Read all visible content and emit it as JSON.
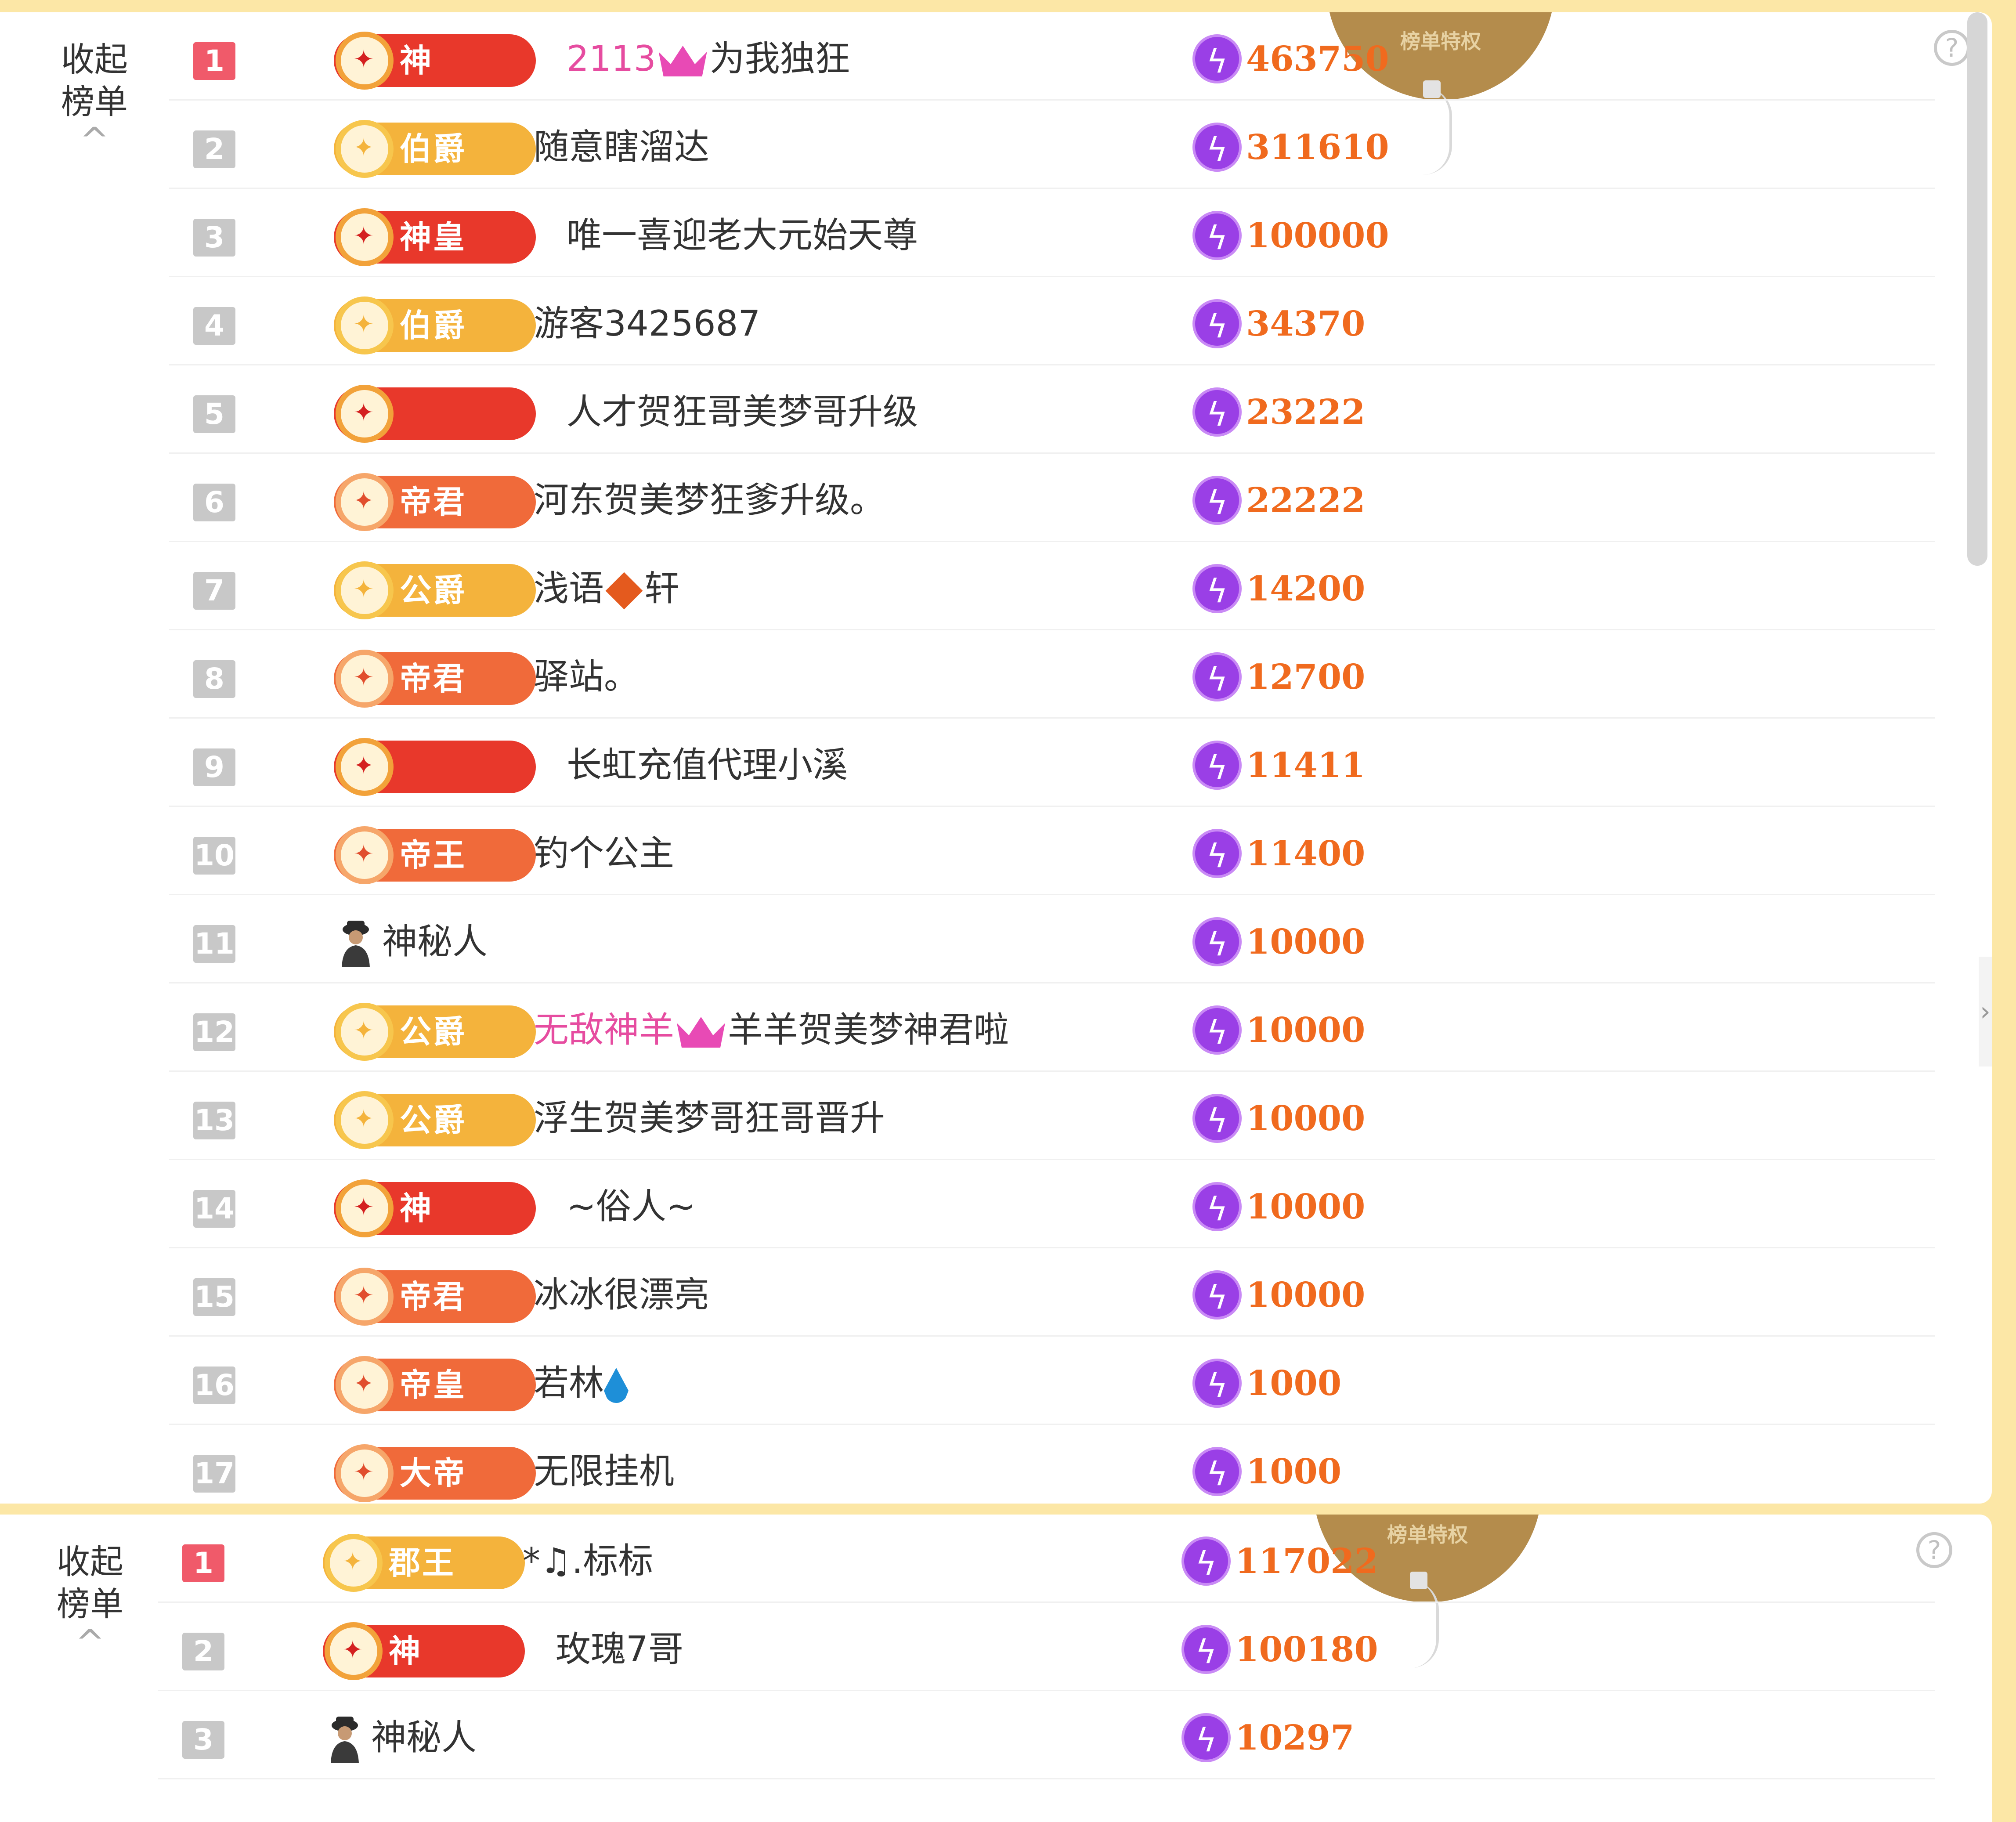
{
  "collapse_label_line1": "收起",
  "collapse_label_line2": "榜单",
  "collapse_caret": "^",
  "help_icon": "?",
  "medal_label": "榜单特权",
  "colors": {
    "score": "#f06a1e",
    "rank_top": "#f05a6a",
    "rank_other": "#c8c8c8",
    "accent_pink": "#e64ca0"
  },
  "board1": {
    "rows": [
      {
        "rank": "1",
        "badge_style": "red",
        "badge_text": "神",
        "name_pink": "2113",
        "crown": true,
        "name": "为我独狂",
        "score": "463750"
      },
      {
        "rank": "2",
        "badge_style": "gold",
        "badge_text": "伯爵",
        "name": "随意瞎溜达",
        "score": "311610"
      },
      {
        "rank": "3",
        "badge_style": "red",
        "badge_text": "神皇",
        "name": "唯一喜迎老大元始天尊",
        "score": "100000"
      },
      {
        "rank": "4",
        "badge_style": "gold",
        "badge_text": "伯爵",
        "name": "游客3425687",
        "score": "34370"
      },
      {
        "rank": "5",
        "badge_style": "red-plain",
        "badge_text": "",
        "name": "人才贺狂哥美梦哥升级",
        "score": "23222"
      },
      {
        "rank": "6",
        "badge_style": "orange",
        "badge_text": "帝君",
        "name": "河东贺美梦狂爹升级。",
        "score": "22222"
      },
      {
        "rank": "7",
        "badge_style": "gold",
        "badge_text": "公爵",
        "name_pre": "浅语",
        "diamond": true,
        "name": "轩",
        "score": "14200"
      },
      {
        "rank": "8",
        "badge_style": "orange",
        "badge_text": "帝君",
        "name": "驿站。",
        "score": "12700"
      },
      {
        "rank": "9",
        "badge_style": "red-plain",
        "badge_text": "",
        "name": "长虹充值代理小溪",
        "score": "11411"
      },
      {
        "rank": "10",
        "badge_style": "orange",
        "badge_text": "帝王",
        "name": "钓个公主",
        "score": "11400"
      },
      {
        "rank": "11",
        "badge_style": "mystery",
        "badge_text": "",
        "name": "神秘人",
        "score": "10000"
      },
      {
        "rank": "12",
        "badge_style": "gold",
        "badge_text": "公爵",
        "name_pink": "无敌神羊",
        "crown": true,
        "name": "羊羊贺美梦神君啦",
        "score": "10000"
      },
      {
        "rank": "13",
        "badge_style": "gold",
        "badge_text": "公爵",
        "name": "浮生贺美梦哥狂哥晋升",
        "score": "10000"
      },
      {
        "rank": "14",
        "badge_style": "red",
        "badge_text": "神",
        "name": "~俗人~",
        "score": "10000"
      },
      {
        "rank": "15",
        "badge_style": "orange",
        "badge_text": "帝君",
        "name": "冰冰很漂亮",
        "score": "10000"
      },
      {
        "rank": "16",
        "badge_style": "orange",
        "badge_text": "帝皇",
        "name": "若林",
        "drop": true,
        "score": "1000"
      },
      {
        "rank": "17",
        "badge_style": "orange",
        "badge_text": "大帝",
        "name": "无限挂机",
        "score": "1000"
      }
    ]
  },
  "board2": {
    "rows": [
      {
        "rank": "1",
        "badge_style": "gold",
        "badge_text": "郡王",
        "name": "*♫.标标",
        "score": "117022"
      },
      {
        "rank": "2",
        "badge_style": "red",
        "badge_text": "神",
        "name": "玫瑰7哥",
        "score": "100180"
      },
      {
        "rank": "3",
        "badge_style": "mystery",
        "badge_text": "",
        "name": "神秘人",
        "score": "10297"
      }
    ]
  }
}
